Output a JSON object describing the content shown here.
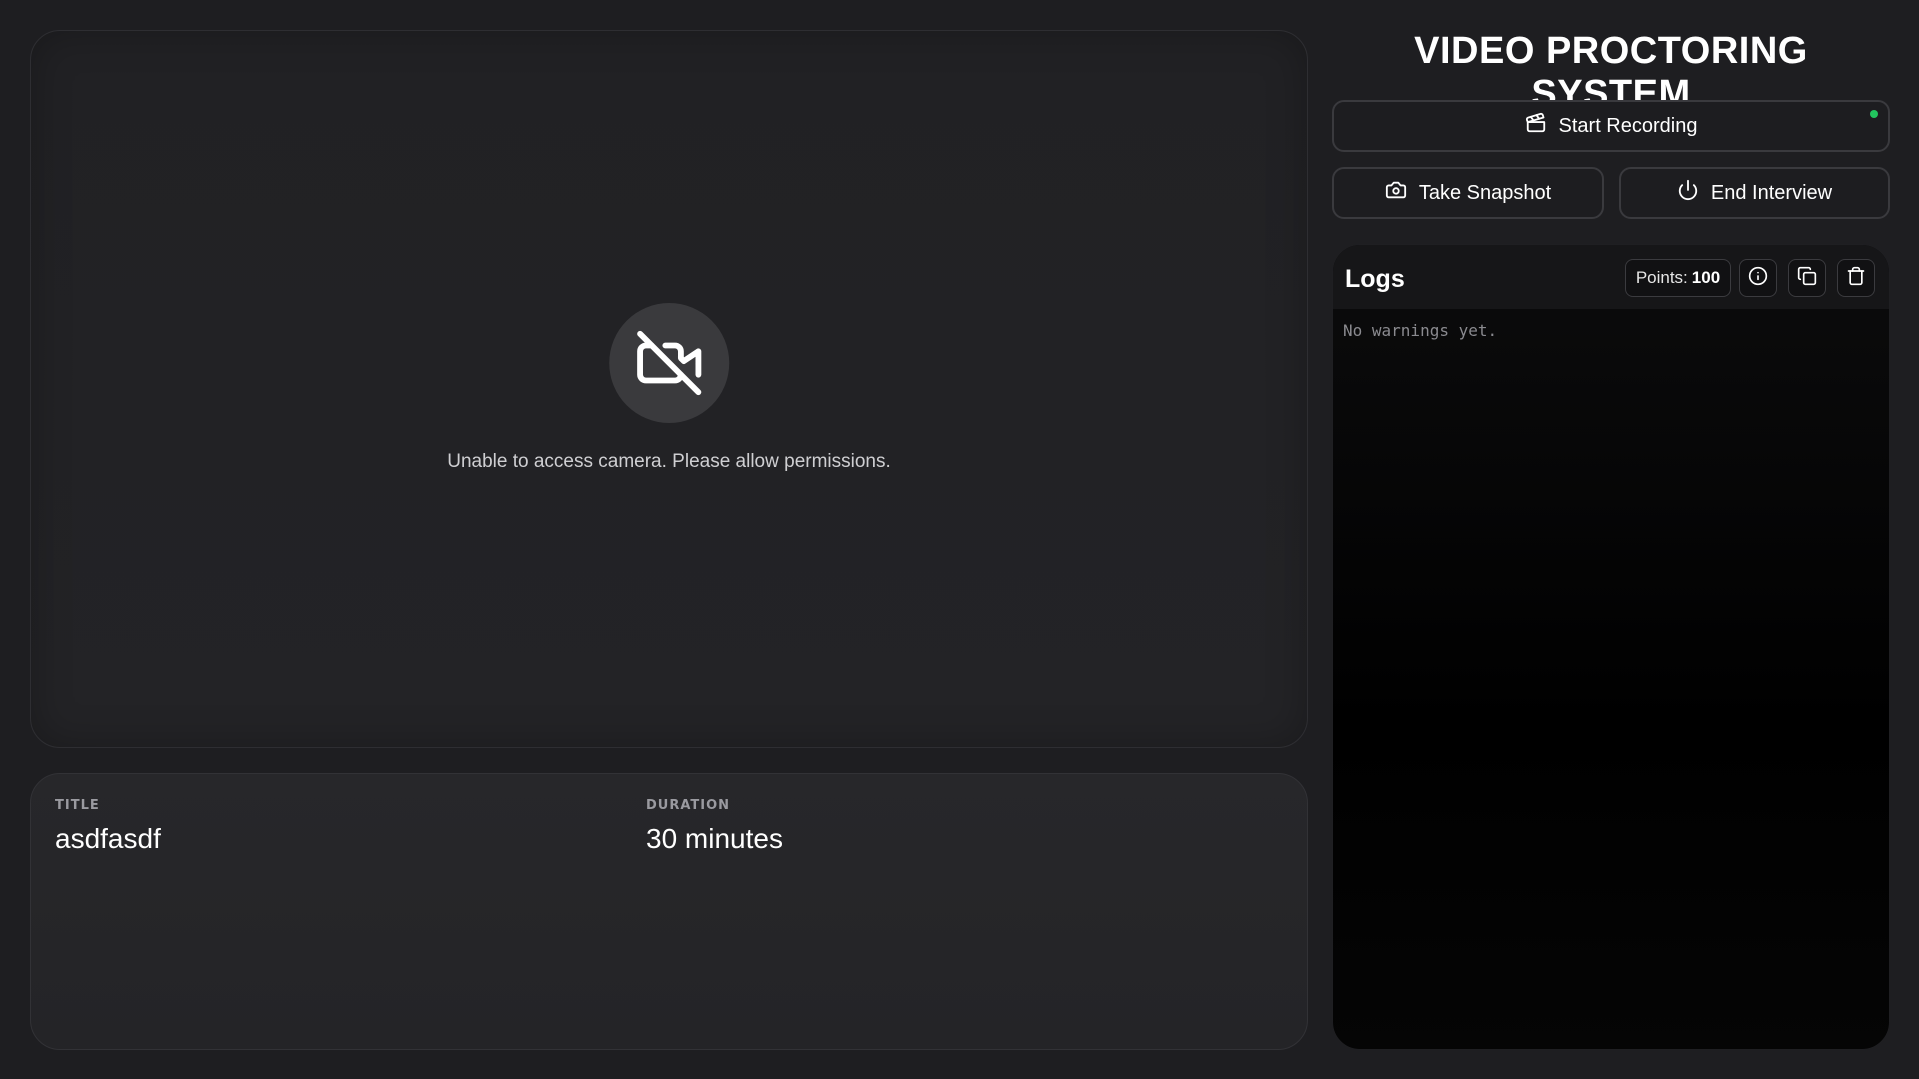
{
  "app": {
    "title": "VIDEO PROCTORING SYSTEM"
  },
  "camera": {
    "icon": "video-off-icon",
    "message": "Unable to access camera. Please allow permissions."
  },
  "interview": {
    "title_label": "TITLE",
    "title_value": "asdfasdf",
    "duration_label": "DURATION",
    "duration_value": "30 minutes"
  },
  "controls": {
    "record_label": "Start Recording",
    "snapshot_label": "Take Snapshot",
    "end_label": "End Interview",
    "status_color": "#22c55e"
  },
  "logs": {
    "title": "Logs",
    "points_label": "Points:",
    "points_value": "100",
    "empty_message": "No warnings yet."
  }
}
